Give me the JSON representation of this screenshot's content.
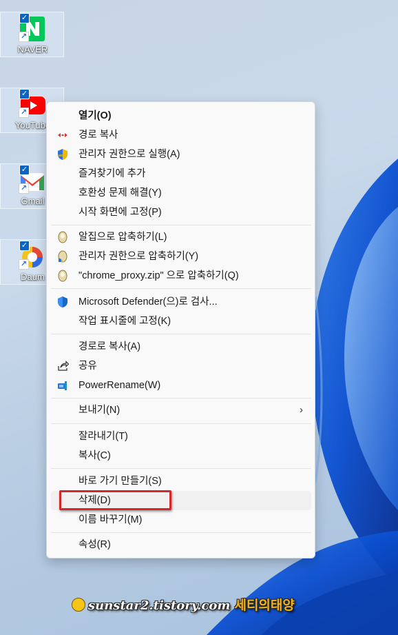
{
  "desktop": {
    "icons": [
      {
        "label": "NAVER",
        "icon": "naver-icon",
        "color": "#03c75a"
      },
      {
        "label": "YouTube",
        "icon": "youtube-icon",
        "color": "#ff0000"
      },
      {
        "label": "Gmail",
        "icon": "gmail-icon",
        "color": "#ea4335"
      },
      {
        "label": "Daum",
        "icon": "daum-icon",
        "color": "#2e6ce6"
      }
    ]
  },
  "context_menu": {
    "groups": [
      [
        {
          "label": "열기(O)",
          "icon": "",
          "bold": true
        },
        {
          "label": "경로 복사",
          "icon": "copy-path-icon"
        },
        {
          "label": "관리자 권한으로 실행(A)",
          "icon": "uac-shield-icon"
        },
        {
          "label": "즐겨찾기에 추가",
          "icon": ""
        },
        {
          "label": "호환성 문제 해결(Y)",
          "icon": ""
        },
        {
          "label": "시작 화면에 고정(P)",
          "icon": ""
        }
      ],
      [
        {
          "label": "알집으로 압축하기(L)",
          "icon": "alzip-icon"
        },
        {
          "label": "관리자 권한으로 압축하기(Y)",
          "icon": "alzip-admin-icon"
        },
        {
          "label": "\"chrome_proxy.zip\" 으로 압축하기(Q)",
          "icon": "alzip-icon"
        }
      ],
      [
        {
          "label": "Microsoft Defender(으)로 검사...",
          "icon": "defender-icon"
        },
        {
          "label": "작업 표시줄에 고정(K)",
          "icon": ""
        }
      ],
      [
        {
          "label": "경로로 복사(A)",
          "icon": ""
        },
        {
          "label": "공유",
          "icon": "share-icon"
        },
        {
          "label": "PowerRename(W)",
          "icon": "powerrename-icon"
        }
      ],
      [
        {
          "label": "보내기(N)",
          "icon": "",
          "submenu": true
        }
      ],
      [
        {
          "label": "잘라내기(T)",
          "icon": ""
        },
        {
          "label": "복사(C)",
          "icon": ""
        }
      ],
      [
        {
          "label": "바로 가기 만들기(S)",
          "icon": ""
        },
        {
          "label": "삭제(D)",
          "icon": "",
          "highlighted": true
        },
        {
          "label": "이름 바꾸기(M)",
          "icon": ""
        }
      ],
      [
        {
          "label": "속성(R)",
          "icon": ""
        }
      ]
    ],
    "submenu_glyph": "›"
  },
  "watermark": {
    "site": "sunstar2.tistory.com",
    "name": "세티의태양"
  },
  "colors": {
    "highlight_border": "#d4272a",
    "menu_bg": "#f9f9f9",
    "accent": "#0b63c4"
  }
}
